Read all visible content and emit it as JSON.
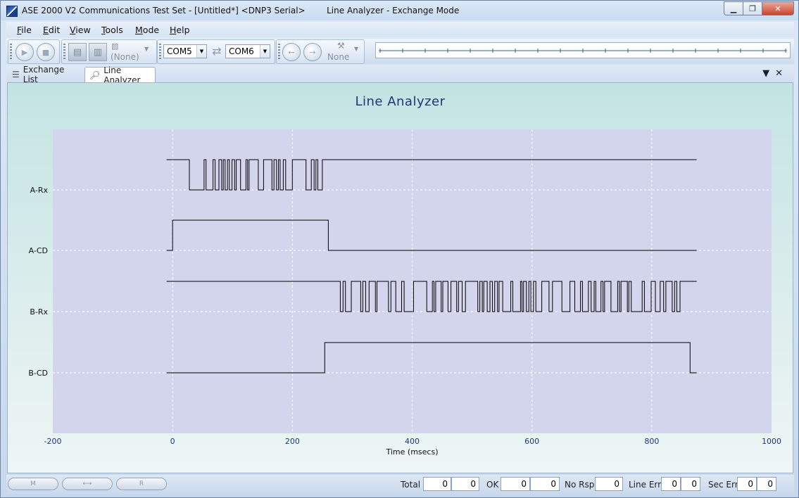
{
  "window": {
    "title": "ASE 2000 V2 Communications Test Set - [Untitled*] <DNP3 Serial>        Line Analyzer - Exchange Mode",
    "buttons": {
      "minimize": "▁",
      "restore": "❐",
      "close": "✕"
    }
  },
  "menu": [
    {
      "label": "File",
      "u": "F",
      "rest": "ile"
    },
    {
      "label": "Edit",
      "u": "E",
      "rest": "dit"
    },
    {
      "label": "View",
      "u": "V",
      "rest": "iew"
    },
    {
      "label": "Tools",
      "u": "T",
      "rest": "ools"
    },
    {
      "label": "Mode",
      "u": "M",
      "rest": "ode"
    },
    {
      "label": "Help",
      "u": "H",
      "rest": "elp"
    }
  ],
  "toolbar": {
    "protocol_label": "(None)",
    "port_a": "COM5",
    "port_b": "COM6",
    "nav_label": "None",
    "icons": {
      "play": "▶",
      "stop": "■"
    }
  },
  "tabs": [
    {
      "label": "Exchange List",
      "icon": "list-icon",
      "active": false
    },
    {
      "label": "Line Analyzer",
      "icon": "analyzer-icon",
      "active": true
    }
  ],
  "tab_controls": {
    "dropdown": "▼",
    "close": "✕"
  },
  "chart_data": {
    "type": "line",
    "title": "Line Analyzer",
    "xlabel": "Time (msecs)",
    "ylabel": "",
    "xlim": [
      -200,
      1000
    ],
    "xticks": [
      -200,
      0,
      200,
      400,
      600,
      800,
      1000
    ],
    "grid": true,
    "channels": [
      {
        "name": "A-Rx",
        "idle": "high",
        "start": -10,
        "end": 875,
        "activity": [
          [
            28,
            250
          ]
        ]
      },
      {
        "name": "A-CD",
        "idle": "low",
        "start": -10,
        "end": 875,
        "high_intervals": [
          [
            0,
            260
          ]
        ]
      },
      {
        "name": "B-Rx",
        "idle": "high",
        "start": -10,
        "end": 875,
        "activity": [
          [
            280,
            852
          ]
        ]
      },
      {
        "name": "B-CD",
        "idle": "low",
        "start": -10,
        "end": 875,
        "high_intervals": [
          [
            254,
            864
          ]
        ]
      }
    ]
  },
  "status": {
    "pills": [
      "M",
      "⟷",
      "R"
    ],
    "total_label": "Total",
    "total": [
      "0",
      "0"
    ],
    "ok_label": "OK",
    "ok": [
      "0",
      "0"
    ],
    "norsp_label": "No Rsp",
    "norsp": [
      "0"
    ],
    "lineerr_label": "Line Err",
    "lineerr": [
      "0",
      "0"
    ],
    "secerr_label": "Sec Err",
    "secerr": [
      "0",
      "0"
    ]
  }
}
